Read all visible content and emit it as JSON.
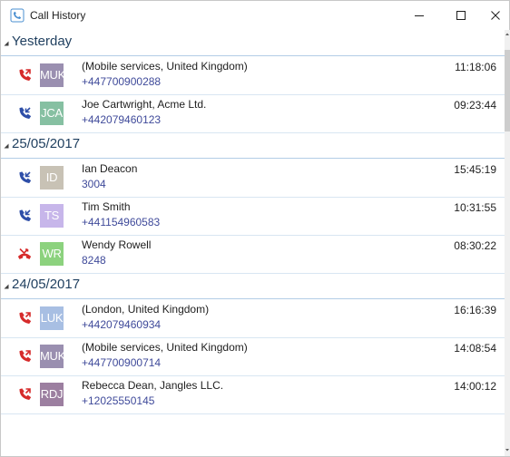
{
  "window": {
    "title": "Call History"
  },
  "groups": [
    {
      "label": "Yesterday",
      "calls": [
        {
          "direction": "outgoing",
          "avatar_text": "MUK",
          "avatar_color": "#9a8fb0",
          "name": "(Mobile services, United Kingdom)",
          "number": "+447700900288",
          "time": "11:18:06"
        },
        {
          "direction": "incoming",
          "avatar_text": "JCA",
          "avatar_color": "#86c0a2",
          "name": "Joe Cartwright, Acme Ltd.",
          "number": "+442079460123",
          "time": "09:23:44"
        }
      ]
    },
    {
      "label": "25/05/2017",
      "calls": [
        {
          "direction": "incoming",
          "avatar_text": "ID",
          "avatar_color": "#c8c2b5",
          "name": "Ian Deacon",
          "number": "3004",
          "time": "15:45:19"
        },
        {
          "direction": "incoming",
          "avatar_text": "TS",
          "avatar_color": "#c7b6ea",
          "name": "Tim Smith",
          "number": "+441154960583",
          "time": "10:31:55"
        },
        {
          "direction": "missed",
          "avatar_text": "WR",
          "avatar_color": "#8cd27e",
          "name": "Wendy Rowell",
          "number": "8248",
          "time": "08:30:22"
        }
      ]
    },
    {
      "label": "24/05/2017",
      "calls": [
        {
          "direction": "outgoing",
          "avatar_text": "LUK",
          "avatar_color": "#a8bfe3",
          "name": "(London, United Kingdom)",
          "number": "+442079460934",
          "time": "16:16:39"
        },
        {
          "direction": "outgoing",
          "avatar_text": "MUK",
          "avatar_color": "#9a8fb0",
          "name": "(Mobile services, United Kingdom)",
          "number": "+447700900714",
          "time": "14:08:54"
        },
        {
          "direction": "outgoing",
          "avatar_text": "RDJ",
          "avatar_color": "#9c7fa0",
          "name": "Rebecca Dean, Jangles LLC.",
          "number": "+12025550145",
          "time": "14:00:12"
        }
      ]
    }
  ],
  "icons": {
    "outgoing": "outgoing-call-icon",
    "incoming": "incoming-call-icon",
    "missed": "missed-call-icon"
  },
  "colors": {
    "outgoing_icon": "#d62b2b",
    "incoming_icon": "#2f4fa8",
    "missed_icon": "#d62b2b",
    "number_text": "#3f4a9a",
    "group_header_text": "#1f3f5f"
  }
}
